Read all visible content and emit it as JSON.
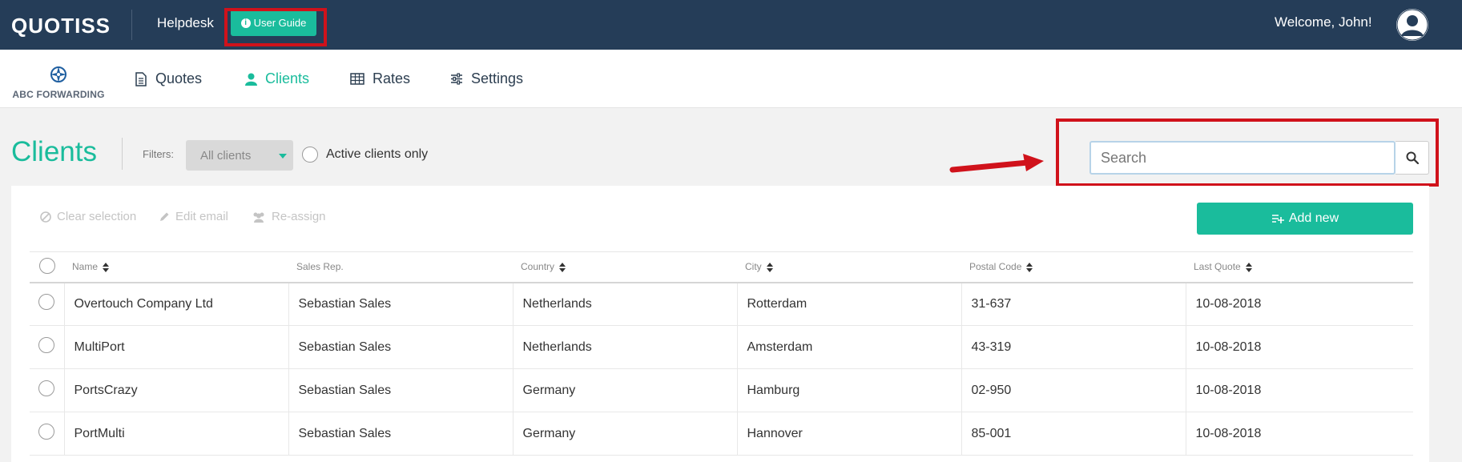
{
  "topbar": {
    "logo": "QUOTISS",
    "helpdesk": "Helpdesk",
    "user_guide": "User Guide",
    "welcome": "Welcome, John!"
  },
  "navbar": {
    "brand": "ABC FORWARDING",
    "items": [
      {
        "label": "Quotes",
        "icon": "document-icon"
      },
      {
        "label": "Clients",
        "icon": "user-icon",
        "active": true
      },
      {
        "label": "Rates",
        "icon": "table-icon"
      },
      {
        "label": "Settings",
        "icon": "sliders-icon"
      }
    ]
  },
  "page": {
    "title": "Clients",
    "filters_label": "Filters:",
    "filter_value": "All clients",
    "active_only": "Active clients only",
    "search_placeholder": "Search"
  },
  "toolbar": {
    "clear_selection": "Clear selection",
    "edit_email": "Edit email",
    "reassign": "Re-assign",
    "add_new": "Add new"
  },
  "table": {
    "columns": [
      "Name",
      "Sales Rep.",
      "Country",
      "City",
      "Postal Code",
      "Last Quote"
    ],
    "rows": [
      [
        "Overtouch Company Ltd",
        "Sebastian Sales",
        "Netherlands",
        "Rotterdam",
        "31-637",
        "10-08-2018"
      ],
      [
        "MultiPort",
        "Sebastian Sales",
        "Netherlands",
        "Amsterdam",
        "43-319",
        "10-08-2018"
      ],
      [
        "PortsCrazy",
        "Sebastian Sales",
        "Germany",
        "Hamburg",
        "02-950",
        "10-08-2018"
      ],
      [
        "PortMulti",
        "Sebastian Sales",
        "Germany",
        "Hannover",
        "85-001",
        "10-08-2018"
      ]
    ]
  },
  "colors": {
    "topbar": "#253d58",
    "accent": "#1abc9c",
    "highlight": "#d0121b"
  }
}
